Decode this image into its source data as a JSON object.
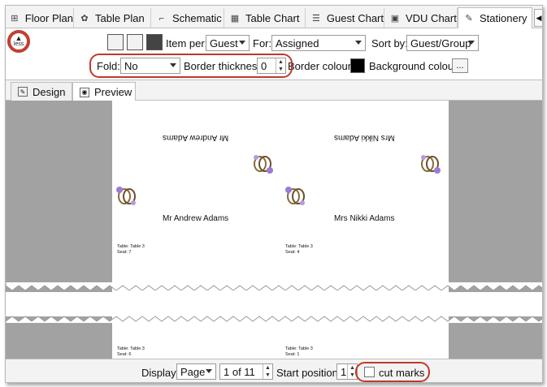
{
  "tabs": [
    {
      "label": "Floor Plan",
      "icon": "floor-plan-icon"
    },
    {
      "label": "Table Plan",
      "icon": "table-plan-icon"
    },
    {
      "label": "Schematic",
      "icon": "schematic-icon"
    },
    {
      "label": "Table Chart",
      "icon": "table-chart-icon"
    },
    {
      "label": "Guest Chart",
      "icon": "guest-chart-icon"
    },
    {
      "label": "VDU Chart",
      "icon": "vdu-chart-icon"
    },
    {
      "label": "Stationery",
      "icon": "stationery-icon"
    }
  ],
  "toolbar": {
    "less_label": "less",
    "item_per_label": "Item per:",
    "item_per_value": "Guest",
    "for_label": "For:",
    "for_value": "Assigned",
    "sort_by_label": "Sort by:",
    "sort_by_value": "Guest/Group",
    "fold_label": "Fold:",
    "fold_value": "No",
    "border_thickness_label": "Border thickness:",
    "border_thickness_value": "0",
    "border_colour_label": "Border colour:",
    "border_colour": "#000000",
    "background_colour_label": "Background colour:",
    "background_colour_button": "..."
  },
  "subtabs": [
    {
      "label": "Design",
      "icon": "design-icon"
    },
    {
      "label": "Preview",
      "icon": "preview-icon"
    }
  ],
  "preview": {
    "cards": [
      {
        "name": "Mr Andrew Adams",
        "table": "Table: Table 3",
        "seat": "Seat: 7"
      },
      {
        "name": "Mrs Nikki Adams",
        "table": "Table: Table 3",
        "seat": "Seat: 4"
      }
    ],
    "lower_cards": [
      {
        "table": "Table: Table 3",
        "seat": "Seat: 6"
      },
      {
        "table": "Table: Table 3",
        "seat": "Seat: 1"
      }
    ]
  },
  "bottom": {
    "display_label": "Display:",
    "display_value": "Page",
    "page_value": "1 of 11",
    "start_position_label": "Start position:",
    "start_position_value": "1",
    "cut_marks_label": "cut marks"
  },
  "colors": {
    "highlight": "#c0392b",
    "preview_bg": "#a2a2a2"
  }
}
